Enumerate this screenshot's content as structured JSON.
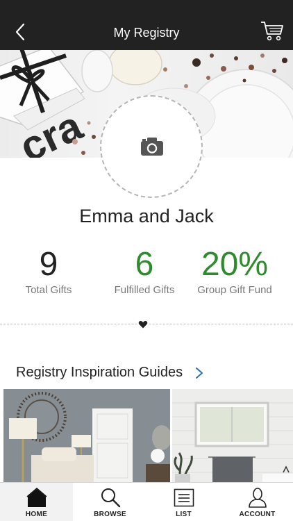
{
  "nav": {
    "title": "My Registry",
    "back_icon": "chevron-left-icon",
    "cart_icon": "shopping-cart-icon"
  },
  "profile": {
    "photo_icon": "camera-icon",
    "couple_name": "Emma and Jack"
  },
  "stats": [
    {
      "value": "9",
      "label": "Total Gifts",
      "color": "#222222"
    },
    {
      "value": "6",
      "label": "Fulfilled Gifts",
      "color": "#2e8b2e"
    },
    {
      "value": "20%",
      "label": "Group Gift Fund",
      "color": "#2e8b2e"
    }
  ],
  "divider_icon": "heart-icon",
  "inspiration": {
    "heading": "Registry Inspiration Guides",
    "chevron_icon": "chevron-right-icon",
    "accent": "#2a6fb0"
  },
  "tabs": [
    {
      "label": "HOME",
      "icon": "home-icon",
      "active": true
    },
    {
      "label": "BROWSE",
      "icon": "search-icon",
      "active": false
    },
    {
      "label": "LIST",
      "icon": "list-icon",
      "active": false
    },
    {
      "label": "ACCOUNT",
      "icon": "person-icon",
      "active": false
    }
  ]
}
